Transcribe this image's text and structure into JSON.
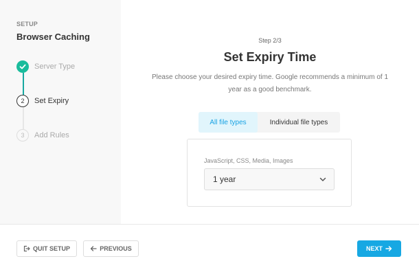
{
  "sidebar": {
    "kicker": "SETUP",
    "title": "Browser Caching",
    "steps": [
      {
        "number": "1",
        "label": "Server Type",
        "state": "done"
      },
      {
        "number": "2",
        "label": "Set Expiry",
        "state": "active"
      },
      {
        "number": "3",
        "label": "Add Rules",
        "state": "pending"
      }
    ]
  },
  "main": {
    "step_count": "Step 2/3",
    "title": "Set Expiry Time",
    "description": "Please choose your desired expiry time. Google recommends a minimum of 1 year as a good benchmark.",
    "tabs": [
      {
        "label": "All file types",
        "selected": true
      },
      {
        "label": "Individual file types",
        "selected": false
      }
    ],
    "field_label": "JavaScript, CSS, Media, Images",
    "select_value": "1 year"
  },
  "footer": {
    "quit_label": "QUIT SETUP",
    "previous_label": "PREVIOUS",
    "next_label": "NEXT"
  },
  "colors": {
    "accent": "#17a8e3",
    "success": "#1abc9c",
    "tab_active_bg": "#e1f5fc"
  },
  "icons": {
    "step_done": "check-icon",
    "quit": "exit-icon",
    "previous": "arrow-left-icon",
    "next": "arrow-right-icon",
    "select": "chevron-down-icon"
  }
}
